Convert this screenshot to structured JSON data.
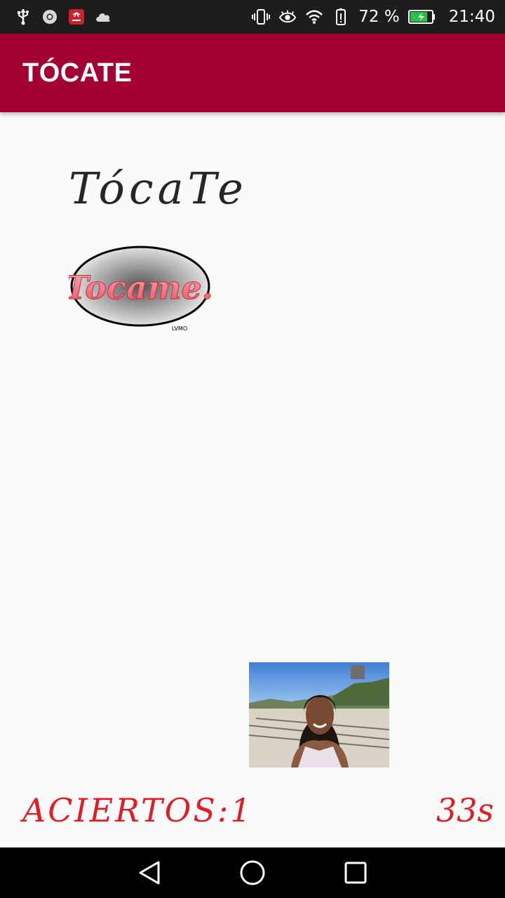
{
  "status_bar": {
    "battery_percent": "72 %",
    "time": "21:40",
    "icons": [
      "usb-icon",
      "chrome-icon",
      "huawei-icon",
      "cloud-icon",
      "vibrate-icon",
      "eye-comfort-icon",
      "wifi-icon",
      "battery-alert-icon",
      "battery-charging-icon"
    ],
    "background": "#1f1c1d"
  },
  "app_bar": {
    "title": "TÓCATE",
    "color": "#a50034"
  },
  "content": {
    "brand_text": "TócaTe",
    "logo_text": "Tocame.",
    "logo_small_text": "LVMO"
  },
  "footer": {
    "score_label": "ACIERTOS:1",
    "timer": "33s",
    "color": "#e31b23"
  },
  "nav_bar": {
    "buttons": [
      "back-icon",
      "home-icon",
      "recents-icon"
    ]
  }
}
